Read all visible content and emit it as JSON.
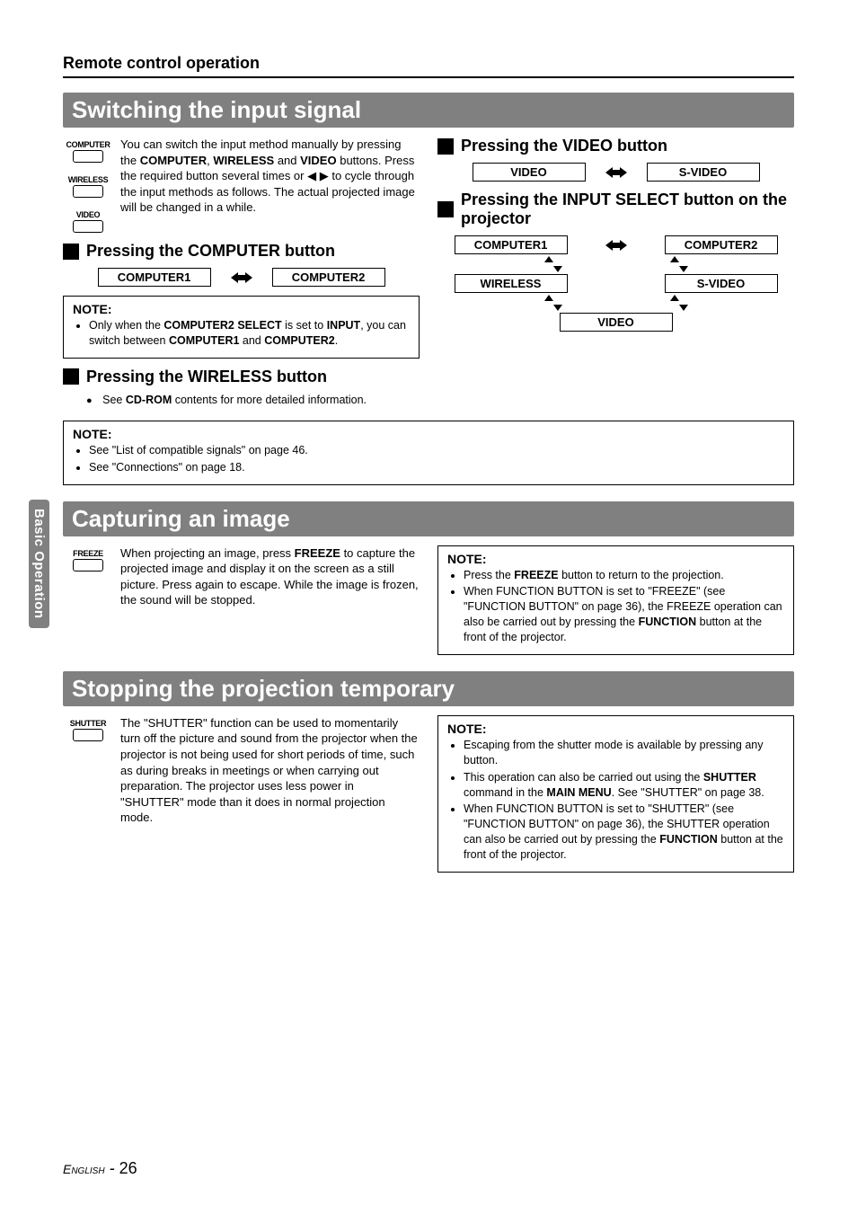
{
  "sideTab": "Basic Operation",
  "pageTitle": "Remote control operation",
  "sections": {
    "switching": {
      "bar": "Switching the input signal",
      "remoteButtons": [
        "COMPUTER",
        "WIRELESS",
        "VIDEO"
      ],
      "intro_a": "You can switch the input method manually by pressing the ",
      "intro_b1": "COMPUTER",
      "intro_c": ", ",
      "intro_b2": "WIRELESS",
      "intro_d": " and ",
      "intro_b3": "VIDEO",
      "intro_e": " buttons. Press the required button several times or ◀ ▶ to cycle through the input methods as follows. The actual projected image will be changed in a while.",
      "computer": {
        "head": "Pressing the COMPUTER button",
        "a": "COMPUTER1",
        "b": "COMPUTER2",
        "noteTitle": "NOTE:",
        "note_a": "Only when the ",
        "note_b1": "COMPUTER2 SELECT",
        "note_c": " is set to ",
        "note_b2": "INPUT",
        "note_d": ", you can switch between ",
        "note_b3": "COMPUTER1",
        "note_e": " and ",
        "note_b4": "COMPUTER2",
        "note_f": "."
      },
      "wireless": {
        "head": "Pressing the WIRELESS button",
        "bullet_a": "See ",
        "bullet_b": "CD-ROM",
        "bullet_c": " contents for more detailed information."
      },
      "video": {
        "head": "Pressing the VIDEO button",
        "a": "VIDEO",
        "b": "S-VIDEO"
      },
      "inputSelect": {
        "head": "Pressing the INPUT SELECT button on the projector",
        "a": "COMPUTER1",
        "b": "COMPUTER2",
        "c": "WIRELESS",
        "d": "S-VIDEO",
        "e": "VIDEO"
      },
      "bottomNote": {
        "title": "NOTE:",
        "li1": "See \"List of compatible signals\" on page 46.",
        "li2": "See \"Connections\" on page 18."
      }
    },
    "capturing": {
      "bar": "Capturing an image",
      "remoteButton": "FREEZE",
      "body_a": "When projecting an image, press ",
      "body_b1": "FREEZE",
      "body_c": " to capture the projected image and display it on the screen as a still picture. Press again to escape. While the image is frozen, the sound will be stopped.",
      "note": {
        "title": "NOTE:",
        "li1_a": "Press the ",
        "li1_b": "FREEZE",
        "li1_c": " button to return to the projection.",
        "li2_a": "When FUNCTION BUTTON is set to \"FREEZE\" (see \"FUNCTION BUTTON\" on page 36), the FREEZE operation can also be carried out by pressing the ",
        "li2_b": "FUNCTION",
        "li2_c": " button at the front of the projector."
      }
    },
    "stopping": {
      "bar": "Stopping the projection temporary",
      "remoteButton": "SHUTTER",
      "body": "The \"SHUTTER\" function can be used to momentarily turn off the picture and sound from the projector when the projector is not being used for short periods of time, such as during breaks in meetings or when carrying out preparation. The projector uses less power in \"SHUTTER\" mode than it does in normal projection mode.",
      "note": {
        "title": "NOTE:",
        "li1": "Escaping from the shutter mode is available by pressing any button.",
        "li2_a": "This operation can also be carried out using the ",
        "li2_b1": "SHUTTER",
        "li2_c": " command in the ",
        "li2_b2": "MAIN MENU",
        "li2_d": ". See \"SHUTTER\" on page 38.",
        "li3_a": "When FUNCTION BUTTON is set to \"SHUTTER\" (see \"FUNCTION BUTTON\" on page 36), the SHUTTER operation can also be carried out by pressing the ",
        "li3_b": "FUNCTION",
        "li3_c": " button at the front of the projector."
      }
    }
  },
  "footer": {
    "lang": "English",
    "sep": " - ",
    "page": "26"
  }
}
